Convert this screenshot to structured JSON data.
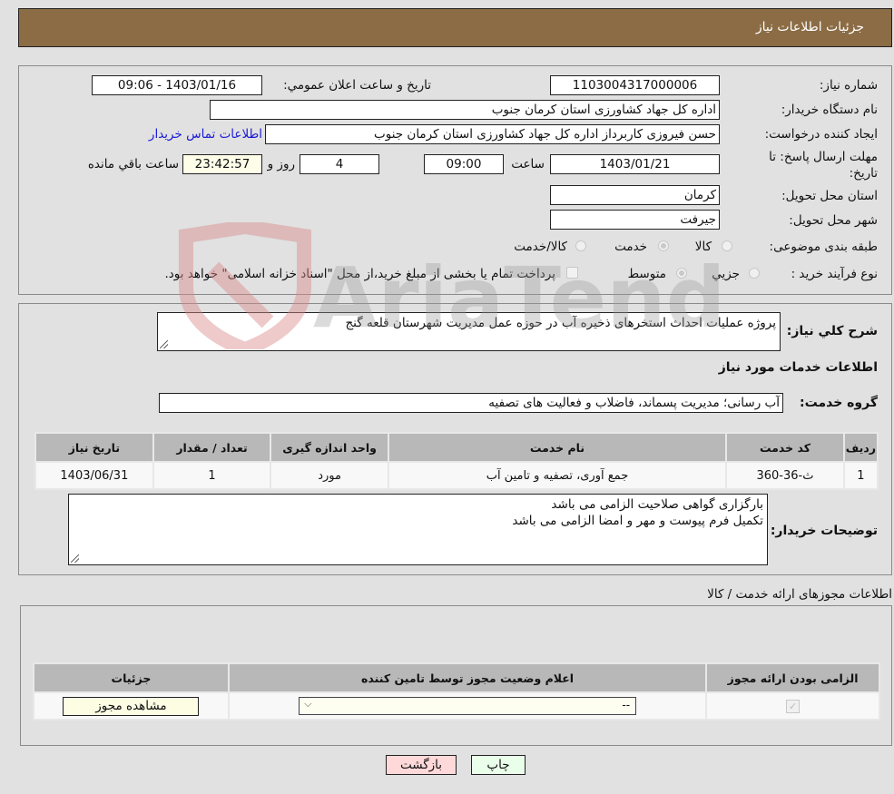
{
  "header": {
    "title": "جزئیات اطلاعات نیاز"
  },
  "details": {
    "need_number_label": "شماره نیاز:",
    "need_number": "1103004317000006",
    "announce_label": "تاريخ و ساعت اعلان عمومي:",
    "announce_value": "1403/01/16 - 09:06",
    "buyer_org_label": "نام دستگاه خريدار:",
    "buyer_org": "اداره کل جهاد کشاورزی استان کرمان   جنوب",
    "creator_label": "ايجاد کننده درخواست:",
    "creator": "حسن فیروزی کاربرداز اداره کل جهاد کشاورزی استان کرمان   جنوب",
    "contact_link": "اطلاعات تماس خريدار",
    "deadline_label": "مهلت ارسال پاسخ: تا تاريخ:",
    "deadline_date": "1403/01/21",
    "time_label": "ساعت",
    "deadline_time": "09:00",
    "days_value": "4",
    "days_label": "روز و",
    "remaining_time": "23:42:57",
    "remaining_label": "ساعت باقي مانده",
    "province_label": "استان محل تحويل:",
    "province": "کرمان",
    "city_label": "شهر محل تحويل:",
    "city": "جيرفت",
    "category_label": "طبقه بندی موضوعی:",
    "category_options": [
      {
        "label": "کالا",
        "checked": false
      },
      {
        "label": "خدمت",
        "checked": true
      },
      {
        "label": "کالا/خدمت",
        "checked": false
      }
    ],
    "process_label": "نوع فرآيند خريد :",
    "process_options": [
      {
        "label": "جزيي",
        "checked": false
      },
      {
        "label": "متوسط",
        "checked": true
      }
    ],
    "treasury_note": "پرداخت تمام يا بخشی از مبلغ خريد،از محل \"اسناد خزانه اسلامی\" خواهد بود."
  },
  "needs": {
    "summary_label": "شرح کلي نياز:",
    "summary": "پروژه عملیات احداث استخرهای ذخیره آب در حوزه عمل مدیریت شهرستان قلعه گنج",
    "services_title": "اطلاعات خدمات مورد نياز",
    "service_group_label": "گروه خدمت:",
    "service_group": "آب رسانی؛ مدیریت پسماند، فاضلاب و فعالیت های تصفیه",
    "table": {
      "headers": [
        "رديف",
        "کد خدمت",
        "نام خدمت",
        "واحد اندازه گيری",
        "تعداد / مقدار",
        "تاريخ نياز"
      ],
      "rows": [
        [
          "1",
          "ث-36-360",
          "جمع آوری، تصفیه و تامین آب",
          "مورد",
          "1",
          "1403/06/31"
        ]
      ]
    },
    "buyer_notes_label": "توضيحات خريدار:",
    "buyer_notes_line1": "بارگزاری گواهی صلاحیت الزامی می باشد",
    "buyer_notes_line2": "تکمیل فرم پیوست و مهر و امضا الزامی می باشد"
  },
  "permits": {
    "title": "اطلاعات مجوزهای ارائه خدمت / کالا",
    "headers": [
      "الزامی بودن ارائه مجوز",
      "اعلام وضعيت مجوز توسط تامين کننده",
      "جزئيات"
    ],
    "row": {
      "required": true,
      "status_value": "--",
      "details_button": "مشاهده مجوز"
    }
  },
  "footer": {
    "print_button": "چاپ",
    "back_button": "بازگشت"
  },
  "watermark": {
    "text": "AriaTender.neT"
  }
}
